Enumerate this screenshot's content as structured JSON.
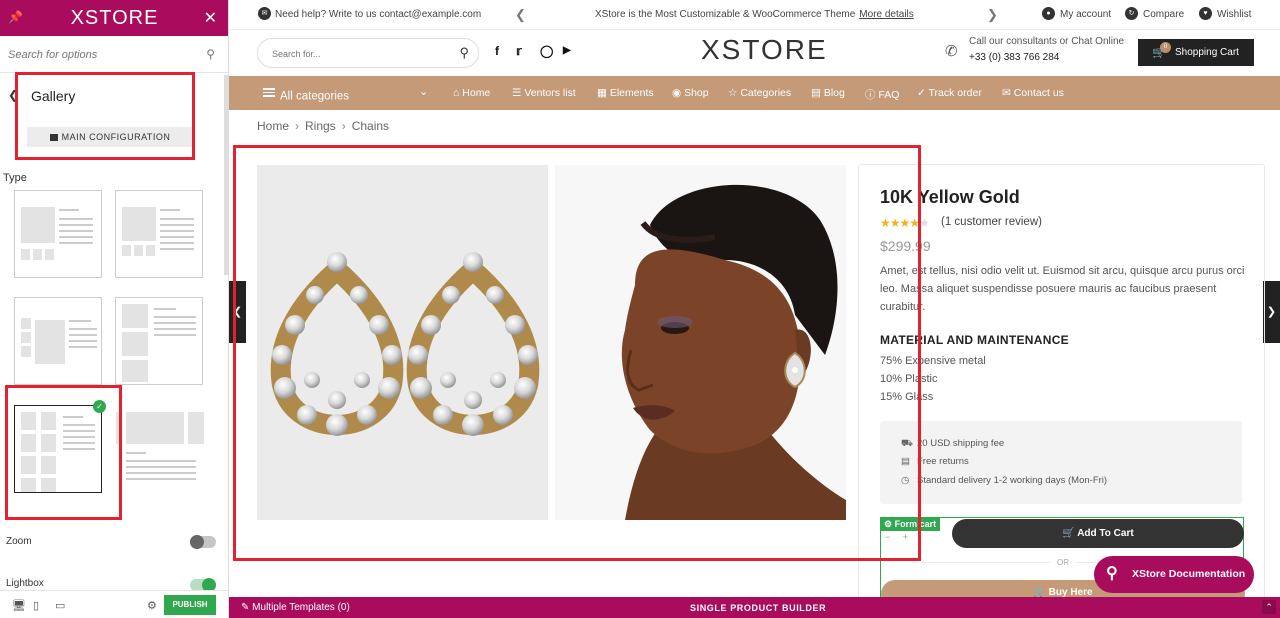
{
  "sidebar": {
    "brand": "XSTORE",
    "search_placeholder": "Search for options",
    "section_title": "Gallery",
    "main_config_label": "MAIN CONFIGURATION",
    "type_label": "Type",
    "selected_layout_index": 4,
    "zoom_label": "Zoom",
    "zoom_enabled": false,
    "lightbox_label": "Lightbox",
    "lightbox_enabled": true,
    "publish_label": "PUBLISH"
  },
  "topbar": {
    "help_text": "Need help? Write to us contact@example.com",
    "promo_text": "XStore is the Most Customizable & WooCommerce Theme",
    "promo_link": "More details",
    "my_account": "My account",
    "compare": "Compare",
    "wishlist": "Wishlist"
  },
  "header": {
    "search_placeholder": "Search for...",
    "logo": "XSTORE",
    "contact_line1": "Call our consultants or Chat Online",
    "contact_phone": "+33 (0) 383 766 284",
    "cart_label": "Shopping Cart",
    "cart_count": "0"
  },
  "nav": {
    "all_categories": "All categories",
    "items": [
      "Home",
      "Ventors list",
      "Elements",
      "Shop",
      "Categories",
      "Blog",
      "FAQ",
      "Track order",
      "Contact us"
    ]
  },
  "breadcrumb": [
    "Home",
    "Rings",
    "Chains"
  ],
  "product": {
    "title": "10K Yellow Gold",
    "rating": 4,
    "review_text": "(1 customer review)",
    "price": "$299.99",
    "description": "Amet, est tellus, nisi odio velit ut. Euismod sit arcu, quisque arcu purus orci leo. Massa aliquet suspendisse posuere mauris ac faucibus praesent curabitur.",
    "material_heading": "MATERIAL AND MAINTENANCE",
    "materials": [
      "75% Expensive metal",
      "10% Plastic",
      "15% Glass"
    ],
    "shipping": [
      "20 USD shipping fee",
      "Free returns",
      "Standard delivery 1-2 working days (Mon-Fri)"
    ],
    "form_cart_tag": "Form cart",
    "add_to_cart": "Add To Cart",
    "or_label": "OR",
    "buy_here": "Buy Here"
  },
  "docs_button": "XStore Documentation",
  "builder_bar": {
    "templates": "Multiple Templates (0)",
    "title": "SINGLE PRODUCT BUILDER"
  },
  "colors": {
    "brand": "#a90c5c",
    "nav_bg": "#c49a78",
    "highlight": "#e2232f",
    "publish": "#2fa84f"
  }
}
